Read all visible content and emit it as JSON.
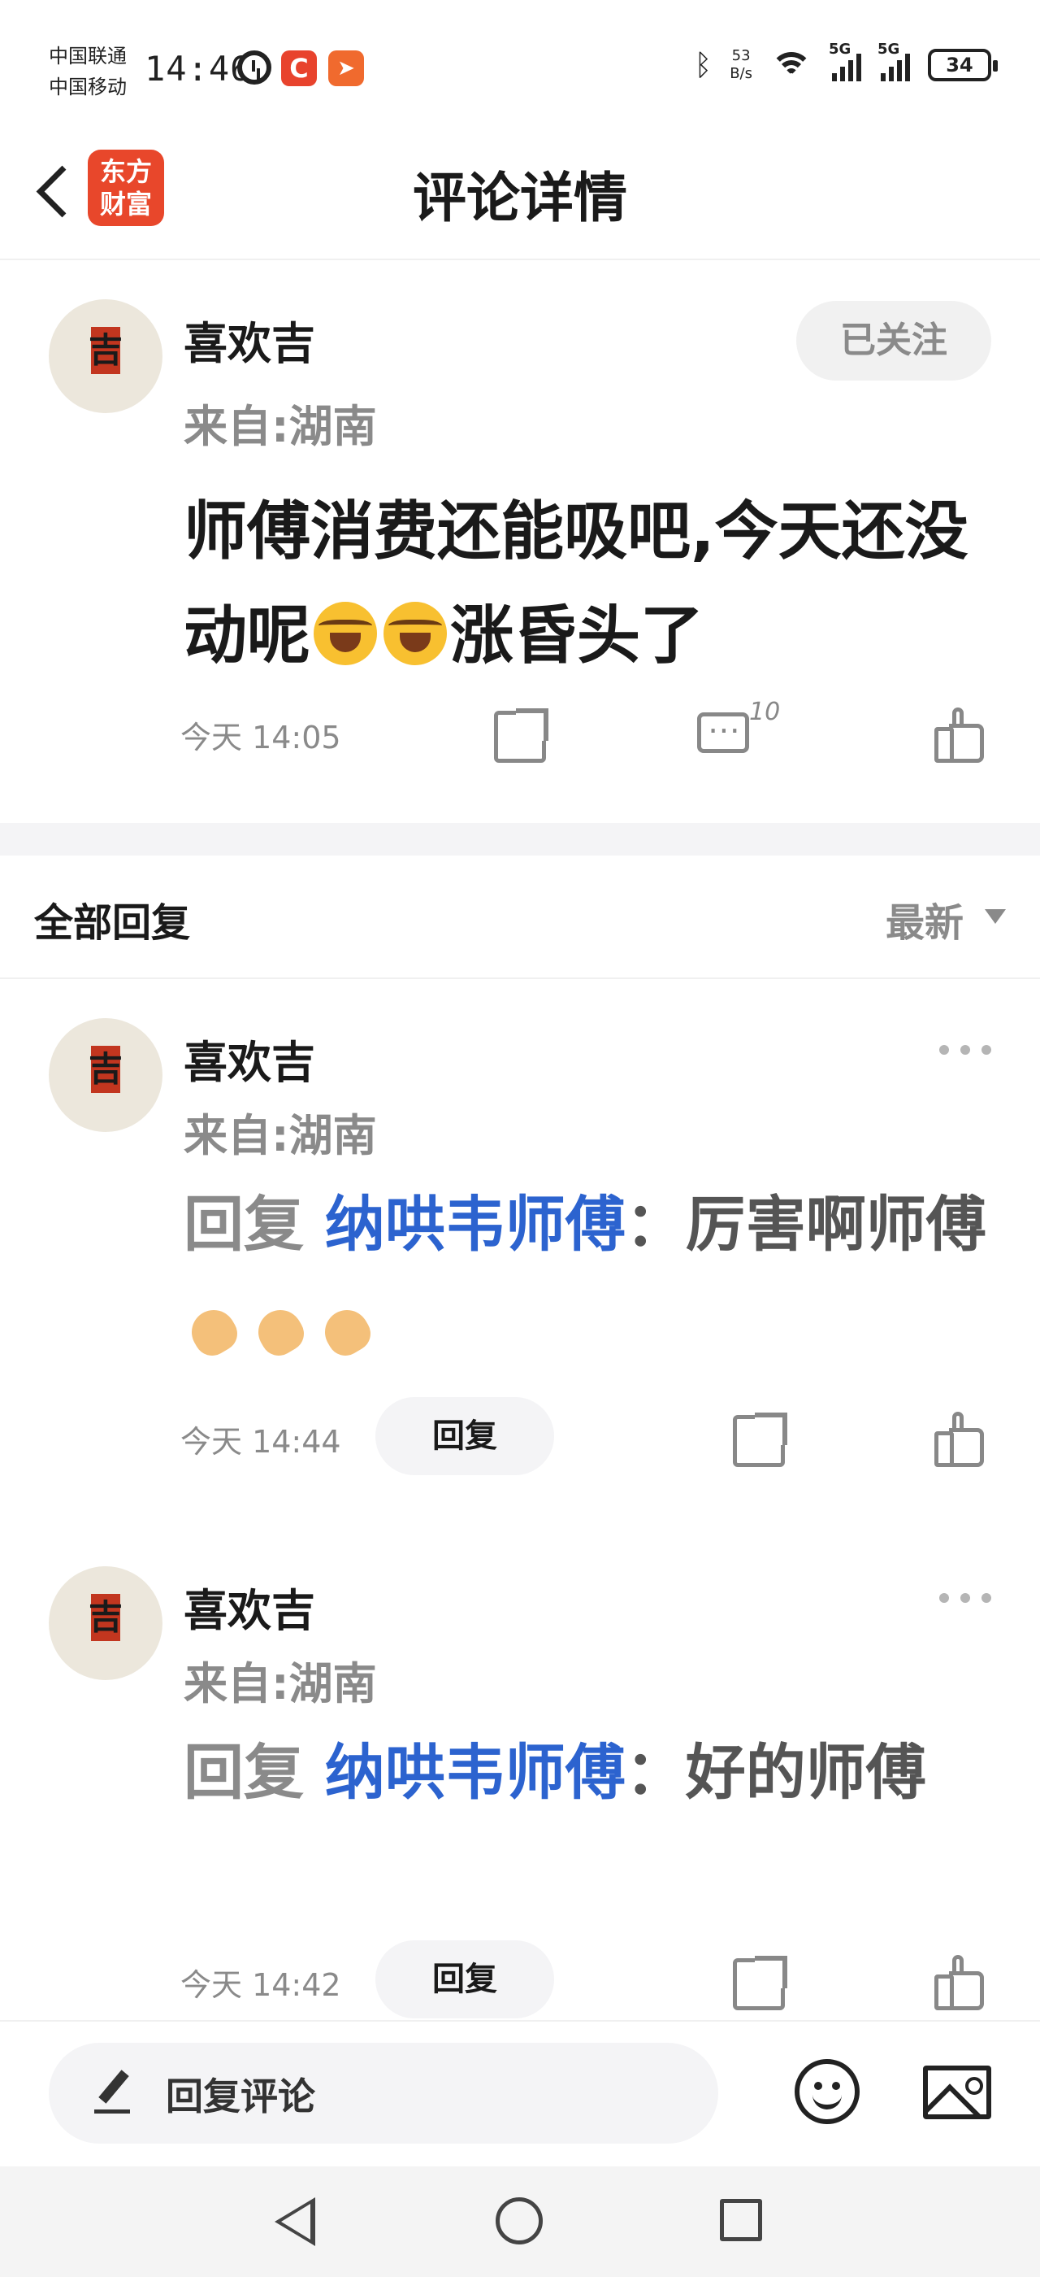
{
  "status_bar": {
    "carrier_1": "中国联通",
    "carrier_2": "中国移动",
    "time": "14:46",
    "net_speed_value": "53",
    "net_speed_unit": "B/s",
    "signal_1_label": "5G",
    "signal_2_label": "5G",
    "battery": "34"
  },
  "header": {
    "logo_line1": "东方",
    "logo_line2": "财富",
    "title": "评论详情"
  },
  "post": {
    "username": "喜欢吉",
    "location": "来自:湖南",
    "follow_label": "已关注",
    "text_part1": "师傅消费还能吸吧,今天还没动呢",
    "text_part2": "涨昏头了",
    "time": "今天 14:05",
    "comment_count": "10"
  },
  "replies_section": {
    "title": "全部回复",
    "sort_label": "最新"
  },
  "replies": [
    {
      "username": "喜欢吉",
      "location": "来自:湖南",
      "prefix": "回复",
      "mention": "纳哄韦师傅",
      "separator": "：",
      "text": "厉害啊师傅",
      "time": "今天 14:44",
      "reply_label": "回复"
    },
    {
      "username": "喜欢吉",
      "location": "来自:湖南",
      "prefix": "回复",
      "mention": "纳哄韦师傅",
      "separator": "：",
      "text": "好的师傅",
      "time": "今天 14:42",
      "reply_label": "回复"
    }
  ],
  "avatar_char": "吉",
  "input": {
    "placeholder": "回复评论"
  },
  "colors": {
    "brand": "#e8472b",
    "mention": "#2c63cf",
    "muted": "#8a8a8a"
  },
  "icons": [
    "back-icon",
    "alarm-icon",
    "bluetooth-icon",
    "wifi-icon",
    "share-icon",
    "comment-icon",
    "like-icon",
    "more-icon",
    "pencil-icon",
    "emoji-icon",
    "image-icon",
    "nav-back-icon",
    "nav-home-icon",
    "nav-recent-icon"
  ]
}
